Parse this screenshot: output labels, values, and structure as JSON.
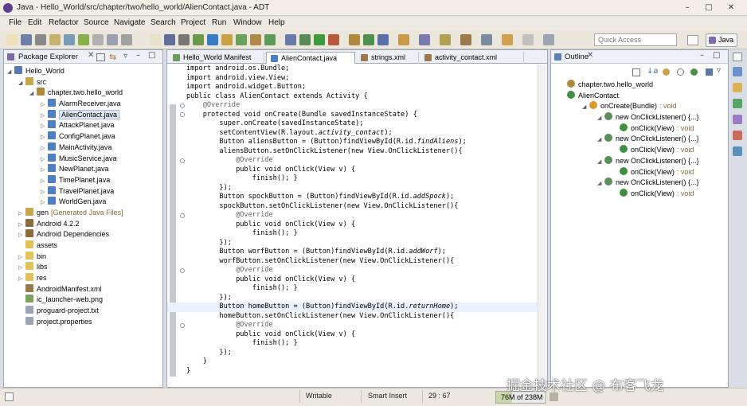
{
  "window": {
    "title": "Java - Hello_World/src/chapter/two/hello_world/AlienContact.java - ADT"
  },
  "menu": [
    "File",
    "Edit",
    "Refactor",
    "Source",
    "Navigate",
    "Search",
    "Project",
    "Run",
    "Window",
    "Help"
  ],
  "toolbar": {
    "quick_access": "Quick Access",
    "perspective": "Java"
  },
  "package_explorer": {
    "title": "Package Explorer",
    "rows": [
      {
        "indent": 0,
        "twisty": "◢",
        "label": "Hello_World",
        "icon": "project-icon",
        "color": "#5b78b0"
      },
      {
        "indent": 1,
        "twisty": "◢",
        "label": "src",
        "icon": "source-folder-icon",
        "color": "#c8a64a"
      },
      {
        "indent": 2,
        "twisty": "◢",
        "label": "chapter.two.hello_world",
        "icon": "package-icon",
        "color": "#b08a3c"
      },
      {
        "indent": 3,
        "twisty": "▷",
        "label": "AlarmReceiver.java",
        "icon": "java-file-icon",
        "color": "#4e7fc2"
      },
      {
        "indent": 3,
        "twisty": "▷",
        "label": "AlienContact.java",
        "icon": "java-file-icon",
        "color": "#4e7fc2",
        "selected": true
      },
      {
        "indent": 3,
        "twisty": "▷",
        "label": "AttackPlanet.java",
        "icon": "java-file-icon",
        "color": "#4e7fc2"
      },
      {
        "indent": 3,
        "twisty": "▷",
        "label": "ConfigPlanet.java",
        "icon": "java-file-icon",
        "color": "#4e7fc2"
      },
      {
        "indent": 3,
        "twisty": "▷",
        "label": "MainActivity.java",
        "icon": "java-file-icon",
        "color": "#4e7fc2"
      },
      {
        "indent": 3,
        "twisty": "▷",
        "label": "MusicService.java",
        "icon": "java-file-icon",
        "color": "#4e7fc2"
      },
      {
        "indent": 3,
        "twisty": "▷",
        "label": "NewPlanet.java",
        "icon": "java-file-icon",
        "color": "#4e7fc2"
      },
      {
        "indent": 3,
        "twisty": "▷",
        "label": "TimePlanet.java",
        "icon": "java-file-icon",
        "color": "#4e7fc2"
      },
      {
        "indent": 3,
        "twisty": "▷",
        "label": "TravelPlanet.java",
        "icon": "java-file-icon",
        "color": "#4e7fc2"
      },
      {
        "indent": 3,
        "twisty": "▷",
        "label": "WorldGen.java",
        "icon": "java-file-icon",
        "color": "#4e7fc2"
      },
      {
        "indent": 1,
        "twisty": "▷",
        "label": "gen",
        "suffix": "[Generated Java Files]",
        "icon": "source-folder-icon",
        "color": "#c8a64a"
      },
      {
        "indent": 1,
        "twisty": "▷",
        "label": "Android 4.2.2",
        "icon": "library-icon",
        "color": "#8a6d3b"
      },
      {
        "indent": 1,
        "twisty": "▷",
        "label": "Android Dependencies",
        "icon": "library-icon",
        "color": "#8a6d3b"
      },
      {
        "indent": 1,
        "twisty": "",
        "label": "assets",
        "icon": "folder-icon",
        "color": "#e2c35a"
      },
      {
        "indent": 1,
        "twisty": "▷",
        "label": "bin",
        "icon": "folder-icon",
        "color": "#e2c35a"
      },
      {
        "indent": 1,
        "twisty": "▷",
        "label": "libs",
        "icon": "folder-icon",
        "color": "#e2c35a"
      },
      {
        "indent": 1,
        "twisty": "▷",
        "label": "res",
        "icon": "folder-icon",
        "color": "#e2c35a"
      },
      {
        "indent": 1,
        "twisty": "",
        "label": "AndroidManifest.xml",
        "icon": "xml-file-icon",
        "color": "#9a7b4f"
      },
      {
        "indent": 1,
        "twisty": "",
        "label": "ic_launcher-web.png",
        "icon": "image-file-icon",
        "color": "#7aa35b"
      },
      {
        "indent": 1,
        "twisty": "",
        "label": "proguard-project.txt",
        "icon": "text-file-icon",
        "color": "#9aa4b2"
      },
      {
        "indent": 1,
        "twisty": "",
        "label": "project.properties",
        "icon": "text-file-icon",
        "color": "#9aa4b2"
      }
    ]
  },
  "editor": {
    "tabs": [
      {
        "label": "Hello_World Manifest",
        "active": false
      },
      {
        "label": "AlienContact.java",
        "active": true
      },
      {
        "label": "strings.xml",
        "active": false
      },
      {
        "label": "activity_contact.xml",
        "active": false
      }
    ],
    "code": [
      "import android.os.Bundle;",
      "import android.view.View;",
      "import android.widget.Button;",
      "public class AlienContact extends Activity {",
      "    @Override",
      "    protected void onCreate(Bundle savedInstanceState) {",
      "        super.onCreate(savedInstanceState);",
      "        setContentView(R.layout.activity_contact);",
      "        Button aliensButton = (Button)findViewById(R.id.findAliens);",
      "        aliensButton.setOnClickListener(new View.OnClickListener(){",
      "            @Override",
      "            public void onClick(View v) {",
      "                finish(); }",
      "        });",
      "        Button spockButton = (Button)findViewById(R.id.addSpock);",
      "        spockButton.setOnClickListener(new View.OnClickListener(){",
      "            @Override",
      "            public void onClick(View v) {",
      "                finish(); }",
      "        });",
      "        Button worfButton = (Button)findViewById(R.id.addWorf);",
      "        worfButton.setOnClickListener(new View.OnClickListener(){",
      "            @Override",
      "            public void onClick(View v) {",
      "                finish(); }",
      "        });",
      "        Button homeButton = (Button)findViewById(R.id.returnHome);",
      "        homeButton.setOnClickListener(new View.OnClickListener(){",
      "            @Override",
      "            public void onClick(View v) {",
      "                finish(); }",
      "        });",
      "    }",
      "}"
    ],
    "highlight_line": 26
  },
  "outline": {
    "title": "Outline",
    "rows": [
      {
        "indent": 0,
        "label": "chapter.two.hello_world",
        "icon": "package-icon",
        "color": "#b08a3c"
      },
      {
        "indent": 0,
        "label": "AlienContact",
        "icon": "class-icon",
        "color": "#3f8f3f"
      },
      {
        "indent": 1,
        "label": "onCreate(Bundle)",
        "suffix": ": void",
        "icon": "method-icon",
        "color": "#d79a2b"
      },
      {
        "indent": 2,
        "label": "new OnClickListener() {...}",
        "icon": "anonymous-class-icon",
        "color": "#5a8f5a"
      },
      {
        "indent": 3,
        "label": "onClick(View)",
        "suffix": ": void",
        "icon": "method-icon",
        "color": "#3f8f3f"
      },
      {
        "indent": 2,
        "label": "new OnClickListener() {...}",
        "icon": "anonymous-class-icon",
        "color": "#5a8f5a"
      },
      {
        "indent": 3,
        "label": "onClick(View)",
        "suffix": ": void",
        "icon": "method-icon",
        "color": "#3f8f3f"
      },
      {
        "indent": 2,
        "label": "new OnClickListener() {...}",
        "icon": "anonymous-class-icon",
        "color": "#5a8f5a"
      },
      {
        "indent": 3,
        "label": "onClick(View)",
        "suffix": ": void",
        "icon": "method-icon",
        "color": "#3f8f3f"
      },
      {
        "indent": 2,
        "label": "new OnClickListener() {...}",
        "icon": "anonymous-class-icon",
        "color": "#5a8f5a"
      },
      {
        "indent": 3,
        "label": "onClick(View)",
        "suffix": ": void",
        "icon": "method-icon",
        "color": "#3f8f3f"
      }
    ]
  },
  "status": {
    "mode": "Writable",
    "insert": "Smart Insert",
    "position": "29 : 67",
    "memory": "76M of 238M",
    "memory_fraction": 0.32
  },
  "watermark": "掘金技术社区 @ 布客飞龙"
}
